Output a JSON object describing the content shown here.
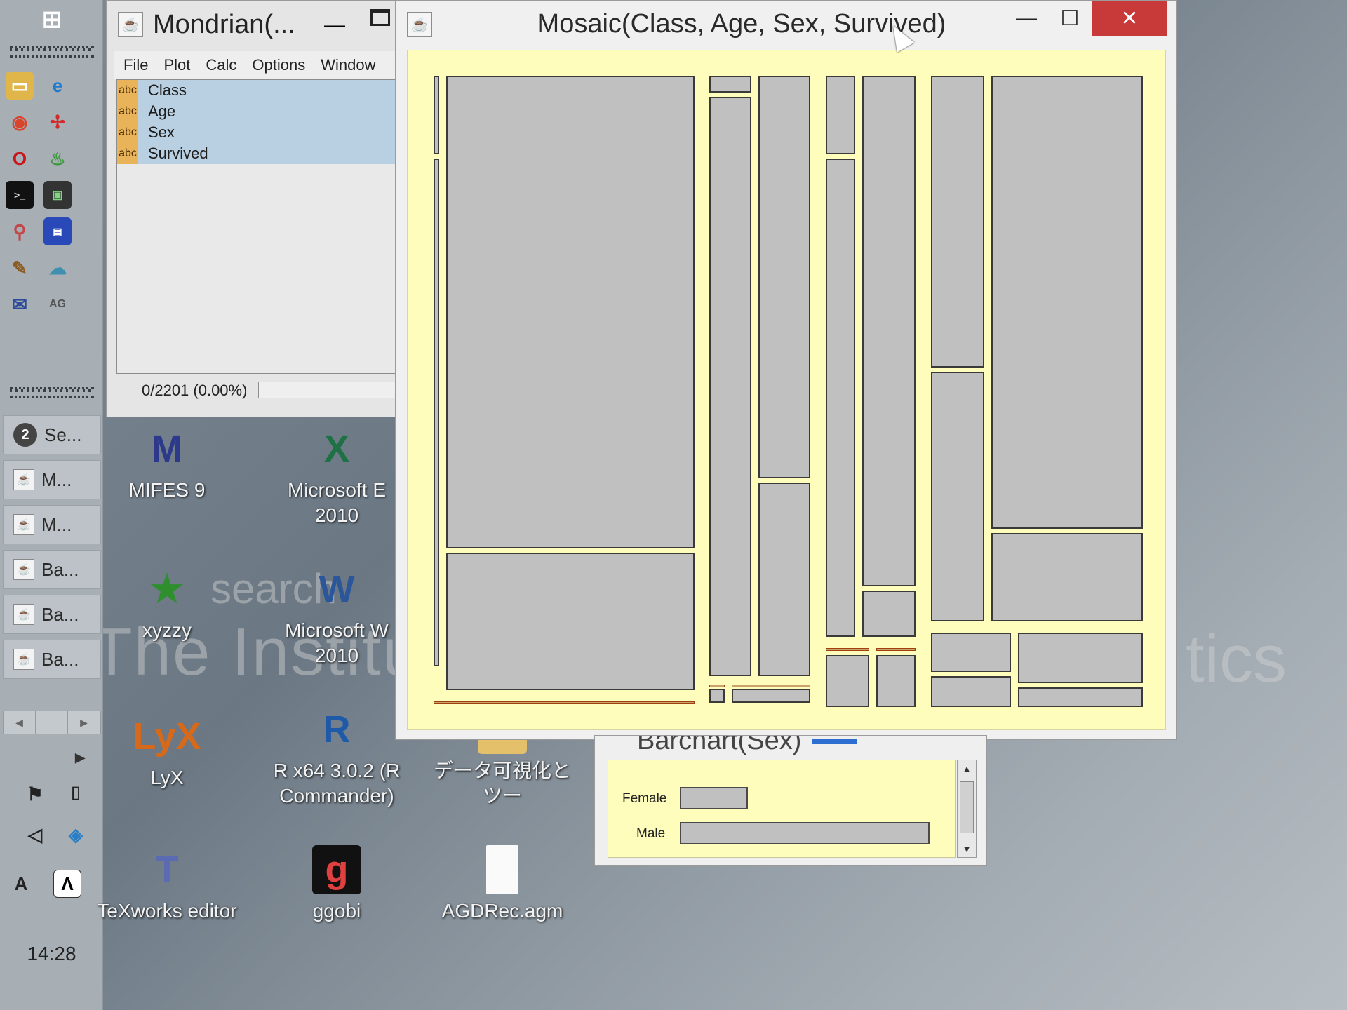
{
  "desktop": {
    "watermark_line1": "The Institu",
    "watermark_line2": "search",
    "watermark_line3": "tics",
    "icons": [
      {
        "name": "mifes-icon",
        "label_1": "MIFES 9",
        "label_2": "",
        "glyph": "M",
        "color": "#2d3a8c"
      },
      {
        "name": "excel-icon",
        "label_1": "Microsoft E",
        "label_2": "2010",
        "glyph": "X",
        "color": "#1e7145"
      },
      {
        "name": "xyzzy-icon",
        "label_1": "xyzzy",
        "label_2": "",
        "glyph": "★",
        "color": "#2f8f2f"
      },
      {
        "name": "word-icon",
        "label_1": "Microsoft W",
        "label_2": "2010",
        "glyph": "W",
        "color": "#2b579a"
      },
      {
        "name": "lyx-icon",
        "label_1": "LyX",
        "label_2": "",
        "glyph": "LyX",
        "color": "#d66a1a"
      },
      {
        "name": "r-icon",
        "label_1": "R x64 3.0.2 (R",
        "label_2": "Commander)",
        "glyph": "R",
        "color": "#1f5aa8"
      },
      {
        "name": "folder-icon",
        "label_1": "データ可視化とツー",
        "label_2": "",
        "glyph": "",
        "color": "#e5c06a"
      },
      {
        "name": "texworks-icon",
        "label_1": "TeXworks editor",
        "label_2": "",
        "glyph": "T",
        "color": "#5b6bb3"
      },
      {
        "name": "ggobi-icon",
        "label_1": "ggobi",
        "label_2": "",
        "glyph": "g",
        "color": "#111111"
      },
      {
        "name": "agdrec-file-icon",
        "label_1": "AGDRec.agm",
        "label_2": "",
        "glyph": "",
        "color": "#ffffff"
      }
    ]
  },
  "taskbar": {
    "items": [
      {
        "label": "Se...",
        "badge": "2"
      },
      {
        "label": "M...",
        "badge": ""
      },
      {
        "label": "M...",
        "badge": ""
      },
      {
        "label": "Ba...",
        "badge": ""
      },
      {
        "label": "Ba...",
        "badge": ""
      },
      {
        "label": "Ba...",
        "badge": ""
      }
    ],
    "clock": "14:28"
  },
  "mondrian": {
    "title": "Mondrian(...",
    "menu": [
      "File",
      "Plot",
      "Calc",
      "Options",
      "Window"
    ],
    "variables": [
      {
        "type": "abc",
        "name": "Class"
      },
      {
        "type": "abc",
        "name": "Age"
      },
      {
        "type": "abc",
        "name": "Sex"
      },
      {
        "type": "abc",
        "name": "Survived"
      }
    ],
    "selection_status": "0/2201 (0.00%)",
    "selection_fraction": 0.0
  },
  "mosaic": {
    "title": "Mosaic(Class, Age, Sex, Survived)",
    "minimize": "—",
    "maximize": "☐",
    "close": "✕"
  },
  "barchart": {
    "title": "Barchart(Sex)",
    "categories": [
      "Female",
      "Male"
    ],
    "values": [
      470,
      1731
    ],
    "max": 1731
  },
  "colors": {
    "plot_background": "#fffdbb",
    "tile_fill": "#c0c0c0",
    "selected_highlight": "#c83a3a"
  }
}
